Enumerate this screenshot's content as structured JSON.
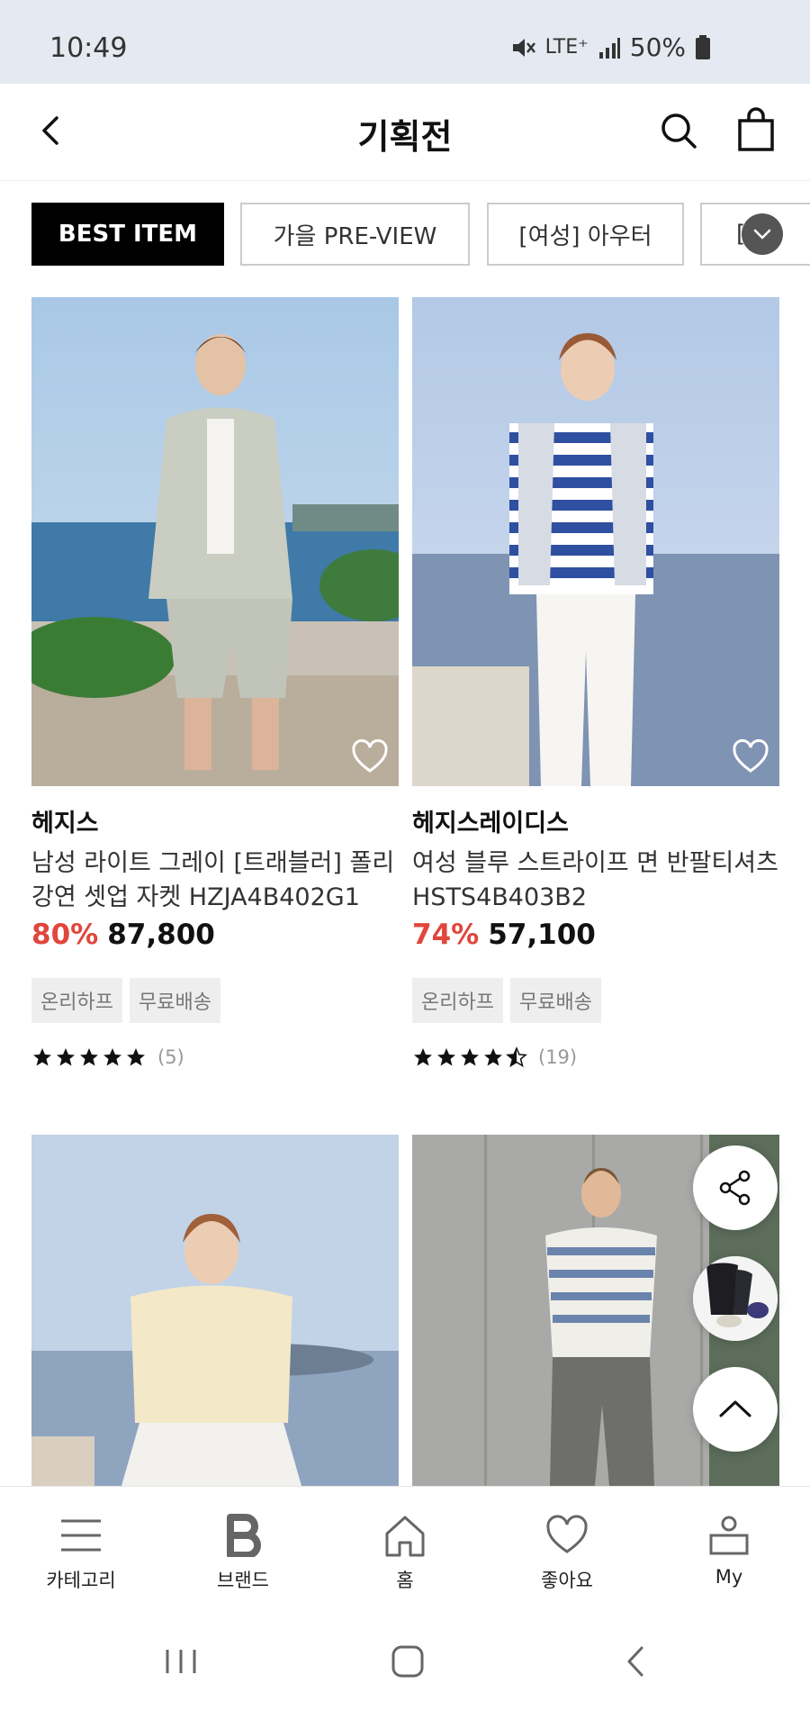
{
  "status_bar": {
    "time": "10:49",
    "network": "LTE⁺",
    "battery": "50%"
  },
  "header": {
    "title": "기획전"
  },
  "tabs": [
    {
      "label": "BEST ITEM",
      "active": true
    },
    {
      "label": "가을 PRE-VIEW",
      "active": false
    },
    {
      "label": "[여성] 아우터",
      "active": false
    },
    {
      "label": "[",
      "active": false
    }
  ],
  "products": [
    {
      "brand": "헤지스",
      "name": "남성 라이트 그레이 [트래블러] 폴리 강연 셋업 자켓 HZJA4B402G1",
      "discount": "80%",
      "price": "87,800",
      "badges": [
        "온리하프",
        "무료배송"
      ],
      "rating": 5,
      "review_count": "(5)"
    },
    {
      "brand": "헤지스레이디스",
      "name": "여성 블루 스트라이프 면 반팔티셔츠 HSTS4B403B2",
      "discount": "74%",
      "price": "57,100",
      "badges": [
        "온리하프",
        "무료배송"
      ],
      "rating": 4.5,
      "review_count": "(19)"
    }
  ],
  "bottom_nav": [
    {
      "label": "카테고리",
      "icon": "menu-icon"
    },
    {
      "label": "브랜드",
      "icon": "brand-b-icon"
    },
    {
      "label": "홈",
      "icon": "home-icon"
    },
    {
      "label": "좋아요",
      "icon": "heart-icon"
    },
    {
      "label": "My",
      "icon": "user-icon"
    }
  ],
  "colors": {
    "discount": "#e0463c",
    "active_tab": "#000000",
    "status_bar_bg": "#e5e9f1"
  }
}
